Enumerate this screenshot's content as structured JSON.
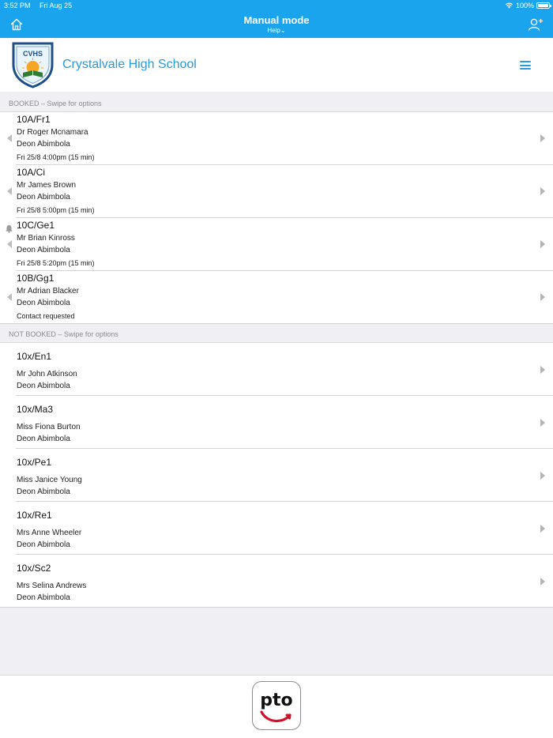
{
  "status_bar": {
    "time": "3:52 PM",
    "date": "Fri Aug 25",
    "battery": "100%"
  },
  "nav": {
    "title": "Manual mode",
    "help": "Help⌄"
  },
  "school": {
    "name": "Crystalvale High School",
    "crest_text": "CVHS"
  },
  "booked": {
    "header": "BOOKED – Swipe for options",
    "rows": [
      {
        "class": "10A/Fr1",
        "teacher": "Dr Roger Mcnamara",
        "student": "Deon Abimbola",
        "time": "Fri 25/8 4:00pm (15 min)"
      },
      {
        "class": "10A/Ci",
        "teacher": "Mr James Brown",
        "student": "Deon Abimbola",
        "time": "Fri 25/8 5:00pm (15 min)"
      },
      {
        "class": "10C/Ge1",
        "teacher": "Mr Brian Kinross",
        "student": "Deon Abimbola",
        "time": "Fri 25/8 5:20pm (15 min)"
      },
      {
        "class": "10B/Gg1",
        "teacher": "Mr Adrian Blacker",
        "student": "Deon Abimbola",
        "time": "Contact requested"
      }
    ]
  },
  "not_booked": {
    "header": "NOT BOOKED – Swipe for options",
    "rows": [
      {
        "class": "10x/En1",
        "teacher": "Mr John Atkinson",
        "student": "Deon Abimbola"
      },
      {
        "class": "10x/Ma3",
        "teacher": "Miss Fiona Burton",
        "student": "Deon Abimbola"
      },
      {
        "class": "10x/Pe1",
        "teacher": "Miss Janice Young",
        "student": "Deon Abimbola"
      },
      {
        "class": "10x/Re1",
        "teacher": "Mrs Anne Wheeler",
        "student": "Deon Abimbola"
      },
      {
        "class": "10x/Sc2",
        "teacher": "Mrs Selina Andrews",
        "student": "Deon Abimbola"
      }
    ]
  },
  "footer": {
    "logo_text": "pto"
  },
  "colors": {
    "accent": "#1aa4ee",
    "school_name": "#2a9ad8",
    "background": "#efeff4",
    "logo_arrow": "#d0112b"
  },
  "icons": {
    "home": "home-icon",
    "add_user": "add-user-icon",
    "menu": "hamburger-menu-icon",
    "bell": "bell-icon",
    "chevron": "chevron-right-icon",
    "swipe": "swipe-left-indicator-icon"
  }
}
